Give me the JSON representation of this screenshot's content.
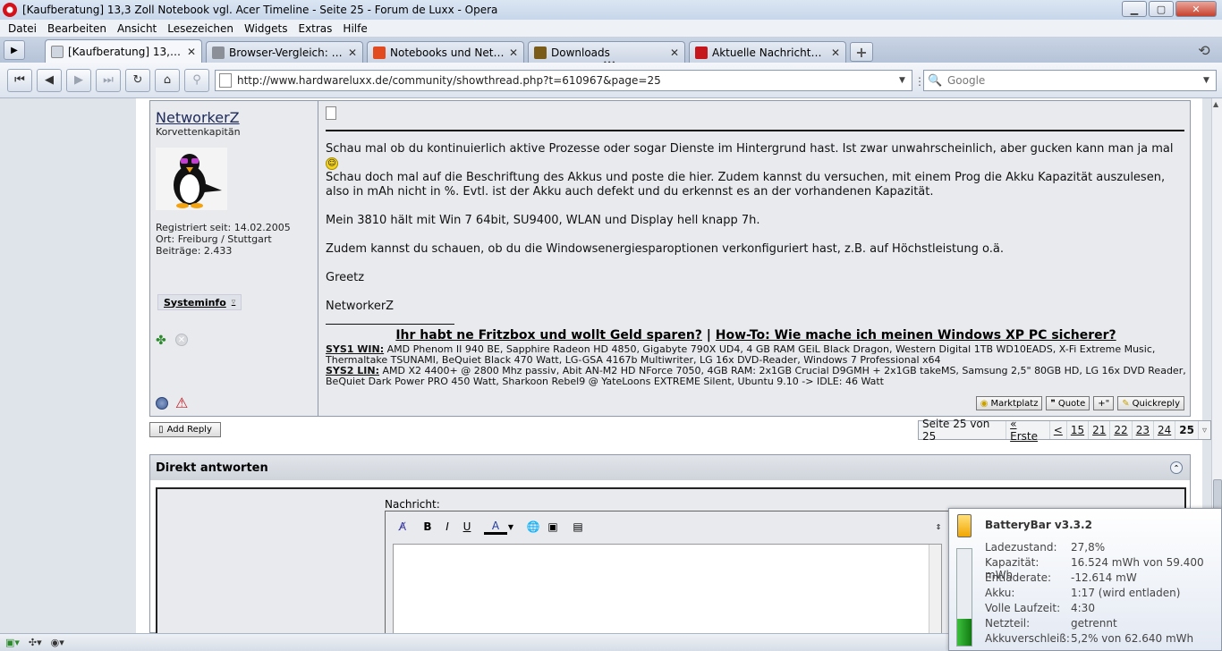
{
  "window": {
    "title": "[Kaufberatung] 13,3 Zoll Notebook vgl. Acer Timeline - Seite 25 - Forum de Luxx - Opera",
    "buttons": {
      "minimize": "▁",
      "maximize": "▢",
      "close": "✕"
    }
  },
  "menu": [
    "Datei",
    "Bearbeiten",
    "Ansicht",
    "Lesezeichen",
    "Widgets",
    "Extras",
    "Hilfe"
  ],
  "tabs": [
    {
      "label": "[Kaufberatung] 13,3 Zo...",
      "active": true
    },
    {
      "label": "Browser-Vergleich: Die ..."
    },
    {
      "label": "Notebooks und Netbo..."
    },
    {
      "label": "Downloads"
    },
    {
      "label": "Aktuelle Nachrichten - ..."
    }
  ],
  "tab_new_label": "+",
  "tab_grip": "•••",
  "address": {
    "url": "http://www.hardwareluxx.de/community/showthread.php?t=610967&page=25"
  },
  "search": {
    "placeholder": "Google"
  },
  "post": {
    "username": "NetworkerZ",
    "rank": "Korvettenkapitän",
    "registered": "Registriert seit: 14.02.2005",
    "location": "Ort: Freiburg / Stuttgart",
    "posts": "Beiträge: 2.433",
    "systeminfo": "Systeminfo",
    "text1": "Schau mal ob du kontinuierlich aktive Prozesse oder sogar Dienste im Hintergrund hast. Ist zwar unwahrscheinlich, aber gucken kann man ja mal",
    "text2": "Schau doch mal auf die Beschriftung des Akkus und poste die hier. Zudem kannst du versuchen, mit einem Prog die Akku Kapazität auszulesen, also in mAh nicht in %. Evtl. ist der Akku auch defekt und du erkennst es an der vorhandenen Kapazität.",
    "text3": "Mein 3810 hält mit Win 7 64bit, SU9400, WLAN und Display hell knapp 7h.",
    "text4": "Zudem kannst du schauen, ob du die Windowsenergiesparoptionen verkonfiguriert hast, z.B. auf Höchstleistung o.ä.",
    "text5": "Greetz",
    "text6": "NetworkerZ",
    "sig_link1": "Ihr habt ne Fritzbox und wollt Geld sparen?",
    "sig_sep": " | ",
    "sig_link2": "How-To: Wie mache ich meinen Windows XP PC sicherer?",
    "sys1_label": "SYS1 WIN:",
    "sys1_text": " AMD Phenom II 940 BE, Sapphire Radeon HD 4850, Gigabyte 790X UD4, 4 GB RAM GEiL Black Dragon, Western Digital 1TB WD10EADS, X-Fi Extreme Music, Thermaltake TSUNAMI, BeQuiet Black 470 Watt, LG-GSA 4167b Multiwriter, LG 16x DVD-Reader, Windows 7 Professional x64",
    "sys2_label": "SYS2 LIN:",
    "sys2_text": " AMD X2 4400+ @ 2800 Mhz passiv, Abit AN-M2 HD NForce 7050, 4GB RAM: 2x1GB Crucial D9GMH + 2x1GB takeMS, Samsung 2,5\" 80GB HD, LG 16x DVD Reader, BeQuiet Dark Power PRO 450 Watt, Sharkoon Rebel9 @ YateLoons EXTREME Silent, Ubuntu 9.10 -> IDLE: 46 Watt",
    "buttons": {
      "marktplatz": "Marktplatz",
      "quote": "Quote",
      "multiquote": "+\"",
      "quickreply": "Quickreply"
    }
  },
  "add_reply": "Add Reply",
  "pager": {
    "info": "Seite 25 von 25",
    "first": "« Erste",
    "prev": "<",
    "pages": [
      "15",
      "21",
      "22",
      "23",
      "24"
    ],
    "current": "25",
    "ext": "▿"
  },
  "quick_reply": {
    "title": "Direkt antworten",
    "message_label": "Nachricht:",
    "toolbar": {
      "bold": "B",
      "italic": "I",
      "underline": "U",
      "fontcolor": "A"
    }
  },
  "battery": {
    "title": "BatteryBar v3.3.2",
    "level": 0.278,
    "rows": [
      {
        "k": "Ladezustand:",
        "v": "27,8%"
      },
      {
        "k": "Kapazität:",
        "v": "16.524 mWh von 59.400 mWh"
      },
      {
        "k": "Entladerate:",
        "v": "-12.614 mW"
      },
      {
        "k": "Akku:",
        "v": "1:17 (wird entladen)"
      },
      {
        "k": "Volle Laufzeit:",
        "v": "4:30"
      },
      {
        "k": "Netzteil:",
        "v": "getrennt"
      },
      {
        "k": "Akkuverschleiß:",
        "v": "5,2% von 62.640 mWh"
      }
    ]
  },
  "colors": {
    "opera_red": "#d3121a",
    "battery_green": "#2aa52a",
    "battery_orange": "#f2a600"
  }
}
